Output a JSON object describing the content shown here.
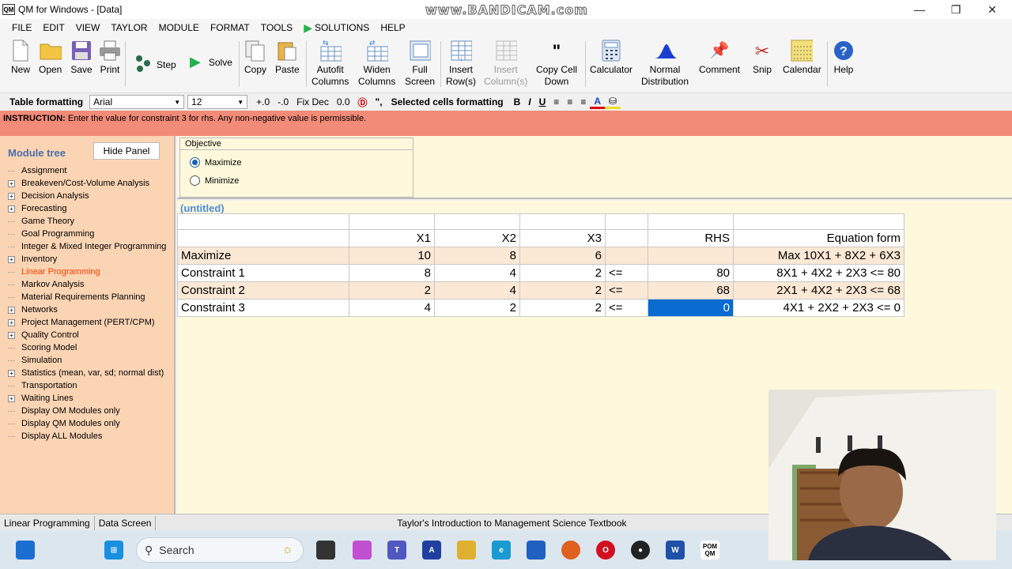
{
  "window": {
    "title": "QM for Windows - [Data]",
    "app_icon": "QM",
    "watermark": "www.BANDICAM.com"
  },
  "menu": [
    "FILE",
    "EDIT",
    "VIEW",
    "TAYLOR",
    "MODULE",
    "FORMAT",
    "TOOLS",
    "SOLUTIONS",
    "HELP"
  ],
  "toolbar": {
    "new": "New",
    "open": "Open",
    "save": "Save",
    "print": "Print",
    "step": "Step",
    "solve": "Solve",
    "copy": "Copy",
    "paste": "Paste",
    "autofit_1": "Autofit",
    "autofit_2": "Columns",
    "widen_1": "Widen",
    "widen_2": "Columns",
    "full_1": "Full",
    "full_2": "Screen",
    "insert_row_1": "Insert",
    "insert_row_2": "Row(s)",
    "insert_col_1": "Insert",
    "insert_col_2": "Column(s)",
    "copy_down_1": "Copy Cell",
    "copy_down_2": "Down",
    "calculator": "Calculator",
    "normal_1": "Normal",
    "normal_2": "Distribution",
    "comment": "Comment",
    "snip": "Snip",
    "calendar": "Calendar",
    "help": "Help"
  },
  "formatbar": {
    "table_label": "Table formatting",
    "font": "Arial",
    "size": "12",
    "fix_dec": "Fix Dec",
    "dec_value": "0.0",
    "selected_label": "Selected cells formatting"
  },
  "instruction": {
    "label": "INSTRUCTION:",
    "text": "Enter the value for constraint 3 for rhs. Any non-negative value is permissible."
  },
  "left_panel": {
    "title": "Module tree",
    "hide_button": "Hide Panel",
    "items": [
      {
        "label": "Assignment",
        "exp": false
      },
      {
        "label": "Breakeven/Cost-Volume Analysis",
        "exp": true
      },
      {
        "label": "Decision Analysis",
        "exp": true
      },
      {
        "label": "Forecasting",
        "exp": true
      },
      {
        "label": "Game Theory",
        "exp": false
      },
      {
        "label": "Goal Programming",
        "exp": false
      },
      {
        "label": "Integer & Mixed Integer Programming",
        "exp": false
      },
      {
        "label": "Inventory",
        "exp": true
      },
      {
        "label": "Linear Programming",
        "exp": false,
        "active": true
      },
      {
        "label": "Markov Analysis",
        "exp": false
      },
      {
        "label": "Material Requirements Planning",
        "exp": false
      },
      {
        "label": "Networks",
        "exp": true
      },
      {
        "label": "Project Management (PERT/CPM)",
        "exp": true
      },
      {
        "label": "Quality Control",
        "exp": true
      },
      {
        "label": "Scoring Model",
        "exp": false
      },
      {
        "label": "Simulation",
        "exp": false
      },
      {
        "label": "Statistics (mean, var, sd; normal dist)",
        "exp": true
      },
      {
        "label": "Transportation",
        "exp": false
      },
      {
        "label": "Waiting Lines",
        "exp": true
      },
      {
        "label": "Display OM Modules only",
        "exp": false
      },
      {
        "label": "Display QM Modules only",
        "exp": false
      },
      {
        "label": "Display ALL Modules",
        "exp": false
      }
    ]
  },
  "objective": {
    "title": "Objective",
    "maximize": "Maximize",
    "minimize": "Minimize",
    "selected": "Maximize"
  },
  "table": {
    "title": "(untitled)",
    "headers": [
      "",
      "X1",
      "X2",
      "X3",
      "",
      "RHS",
      "Equation form"
    ],
    "rows": [
      [
        "Maximize",
        "10",
        "8",
        "6",
        "",
        "",
        "Max  10X1 +  8X2 +  6X3"
      ],
      [
        "Constraint 1",
        "8",
        "4",
        "2",
        "<=",
        "80",
        "8X1 +  4X2 +  2X3 <= 80"
      ],
      [
        "Constraint 2",
        "2",
        "4",
        "2",
        "<=",
        "68",
        "2X1 +  4X2 +  2X3 <= 68"
      ],
      [
        "Constraint 3",
        "4",
        "2",
        "2",
        "<=",
        "0",
        "4X1 +  2X2 +  2X3 <= 0"
      ]
    ],
    "selected_cell": "Constraint 3 RHS"
  },
  "status": {
    "module": "Linear Programming",
    "screen": "Data Screen",
    "book": "Taylor's Introduction to Management Science Textbook"
  },
  "taskbar": {
    "search_placeholder": "Search",
    "pom_label": "POM QM"
  }
}
